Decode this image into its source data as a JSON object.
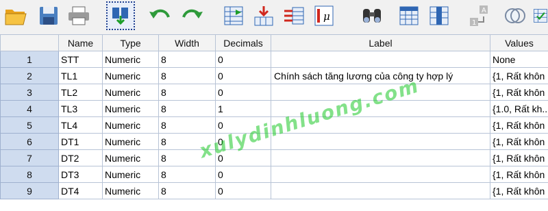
{
  "toolbar": {
    "icons": [
      "open-folder-icon",
      "save-icon",
      "print-icon",
      "recall-dialog-icon",
      "undo-icon",
      "redo-icon",
      "goto-case-icon",
      "goto-variable-icon",
      "variables-icon",
      "run-descriptives-icon",
      "find-icon",
      "insert-cases-icon",
      "insert-variable-icon",
      "split-file-icon",
      "weight-cases-icon",
      "select-cases-icon"
    ]
  },
  "grid": {
    "columns": [
      "Name",
      "Type",
      "Width",
      "Decimals",
      "Label",
      "Values"
    ],
    "rows": [
      {
        "num": "1",
        "name": "STT",
        "type": "Numeric",
        "width": "8",
        "decimals": "0",
        "label": "",
        "values": "None"
      },
      {
        "num": "2",
        "name": "TL1",
        "type": "Numeric",
        "width": "8",
        "decimals": "0",
        "label": "Chính sách tăng lương của công ty hợp lý",
        "values": "{1, Rất khôn"
      },
      {
        "num": "3",
        "name": "TL2",
        "type": "Numeric",
        "width": "8",
        "decimals": "0",
        "label": "",
        "values": "{1, Rất khôn"
      },
      {
        "num": "4",
        "name": "TL3",
        "type": "Numeric",
        "width": "8",
        "decimals": "1",
        "label": "",
        "values": "{1.0, Rất kh..."
      },
      {
        "num": "5",
        "name": "TL4",
        "type": "Numeric",
        "width": "8",
        "decimals": "0",
        "label": "",
        "values": "{1, Rất khôn"
      },
      {
        "num": "6",
        "name": "DT1",
        "type": "Numeric",
        "width": "8",
        "decimals": "0",
        "label": "",
        "values": "{1, Rất khôn"
      },
      {
        "num": "7",
        "name": "DT2",
        "type": "Numeric",
        "width": "8",
        "decimals": "0",
        "label": "",
        "values": "{1, Rất khôn"
      },
      {
        "num": "8",
        "name": "DT3",
        "type": "Numeric",
        "width": "8",
        "decimals": "0",
        "label": "",
        "values": "{1, Rất khôn"
      },
      {
        "num": "9",
        "name": "DT4",
        "type": "Numeric",
        "width": "8",
        "decimals": "0",
        "label": "",
        "values": "{1, Rất khôn"
      }
    ]
  },
  "watermark": "xulydinhluong.com"
}
